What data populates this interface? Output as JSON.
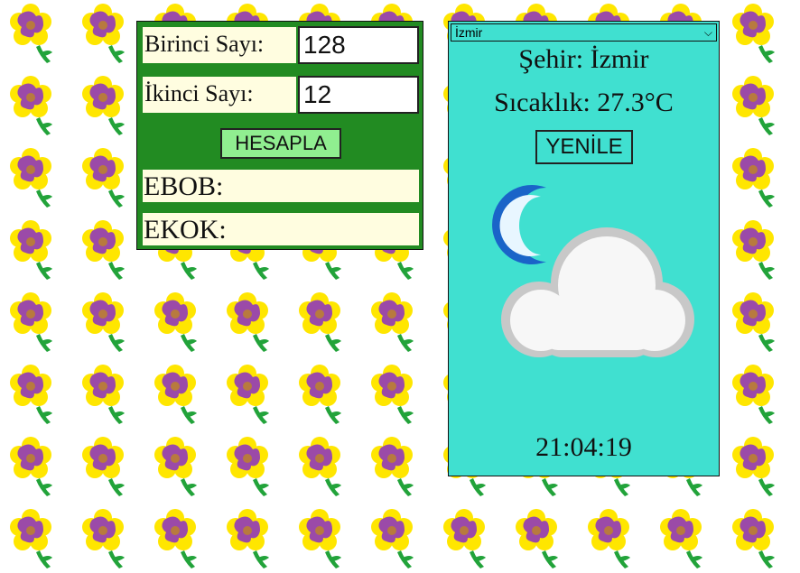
{
  "calculator": {
    "first_label": "Birinci Sayı:",
    "first_value": "128",
    "second_label": "İkinci Sayı:",
    "second_value": "12",
    "calculate_label": "HESAPLA",
    "gcd_label": "EBOB:",
    "lcm_label": "EKOK:"
  },
  "weather": {
    "selected_city": "İzmir",
    "city_text": "Şehir: İzmir",
    "temperature_text": "Sıcaklık: 27.3°C",
    "refresh_label": "YENİLE",
    "icon": "night-cloudy-icon",
    "time": "21:04:19"
  },
  "colors": {
    "calc_panel": "#228b22",
    "label_bg": "#fffde0",
    "calc_button": "#90ee90",
    "weather_panel": "#40e0d0"
  }
}
